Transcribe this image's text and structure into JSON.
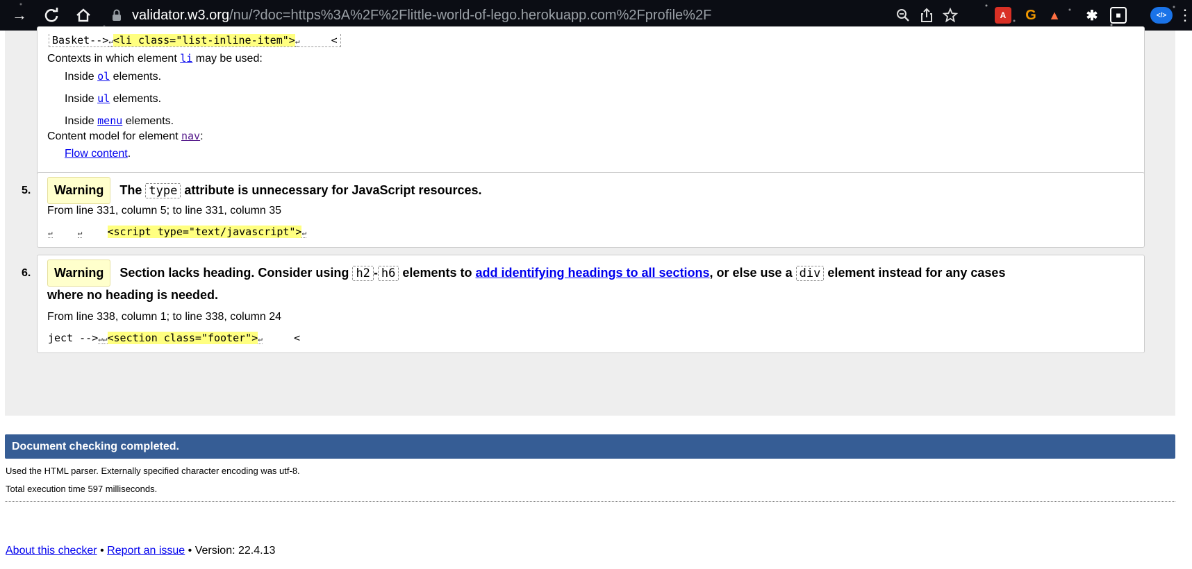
{
  "browser": {
    "url_host": "validator.w3.org",
    "url_rest": "/nu/?doc=https%3A%2F%2Flittle-world-of-lego.herokuapp.com%2Fprofile%2F",
    "icons": [
      "forward-icon",
      "reload-icon",
      "home-icon",
      "lock-icon",
      "zoom-icon",
      "share-icon",
      "bookmark-star-icon",
      "pdf-extension-icon",
      "grammarly-extension-icon",
      "extension-icon",
      "puzzle-extensions-icon",
      "window-icon",
      "devtools-extension-icon"
    ]
  },
  "message4_tail": {
    "code_prefix": "Basket-->",
    "code_highlight": "<li class=\"list-inline-item\">",
    "code_suffix": "<",
    "contexts_label": "Contexts in which element",
    "contexts_element": "li",
    "contexts_suffix": "may be used:",
    "contexts": [
      {
        "prefix": "Inside",
        "element": "ol",
        "suffix": "elements."
      },
      {
        "prefix": "Inside",
        "element": "ul",
        "suffix": "elements."
      },
      {
        "prefix": "Inside",
        "element": "menu",
        "suffix": "elements."
      }
    ],
    "content_model_label": "Content model for element",
    "content_model_element": "nav",
    "content_model_colon": ":",
    "content_model_value": "Flow content",
    "content_model_period": "."
  },
  "message5": {
    "number": "5.",
    "badge": "Warning",
    "title_pre": "The",
    "title_code": "type",
    "title_post": "attribute is unnecessary for JavaScript resources.",
    "location": "From line 331, column 5; to line 331, column 35",
    "code_highlight": "<script type=\"text/javascript\">"
  },
  "message6": {
    "number": "6.",
    "badge": "Warning",
    "title_pre": "Section lacks heading. Consider using",
    "code_a": "h2",
    "dash": "-",
    "code_b": "h6",
    "title_mid": "elements to",
    "link": "add identifying headings to all sections",
    "title_post": ", or else use a",
    "code_c": "div",
    "title_end_line1": "element instead for any cases",
    "title_line2": "where no heading is needed.",
    "location": "From line 338, column 1; to line 338, column 24",
    "code_prefix": "ject -->",
    "code_highlight": "<section class=\"footer\">",
    "code_suffix": "<"
  },
  "completion": {
    "title": "Document checking completed.",
    "parser_note": "Used the HTML parser. Externally specified character encoding was utf-8.",
    "time_note": "Total execution time 597 milliseconds."
  },
  "footer": {
    "about": "About this checker",
    "sep1": "•",
    "report": "Report an issue",
    "sep2": "•",
    "version": "Version: 22.4.13"
  },
  "colors": {
    "done_bar": "#365d95",
    "highlight": "#ffff80",
    "warning_badge": "#ffffcc",
    "link": "#0000ee"
  }
}
